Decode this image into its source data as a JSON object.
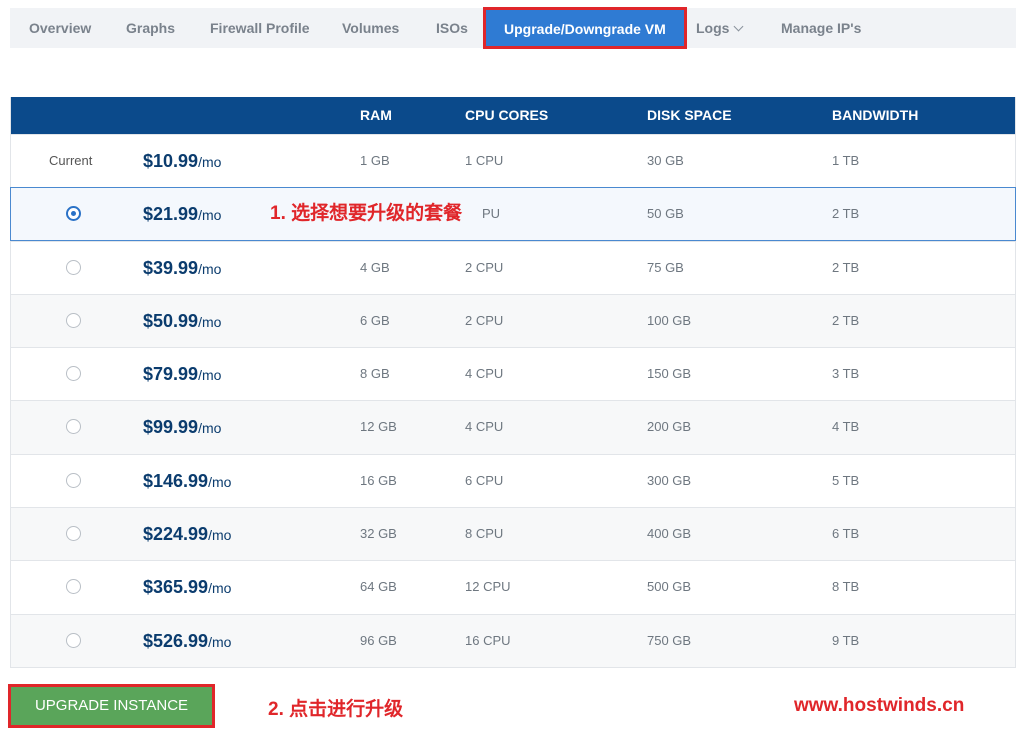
{
  "tabs": [
    {
      "label": "Overview"
    },
    {
      "label": "Graphs"
    },
    {
      "label": "Firewall Profile"
    },
    {
      "label": "Volumes"
    },
    {
      "label": "ISOs"
    },
    {
      "label": "Upgrade/Downgrade VM"
    },
    {
      "label": "Logs"
    },
    {
      "label": "Manage IP's"
    }
  ],
  "active_tab": "Upgrade/Downgrade VM",
  "table": {
    "headers": {
      "ram": "RAM",
      "cpu": "CPU CORES",
      "disk": "DISK SPACE",
      "bandwidth": "BANDWIDTH"
    },
    "current_label": "Current",
    "per_unit": "/mo",
    "rows": [
      {
        "price": "$10.99",
        "ram": "1 GB",
        "cpu": "1 CPU",
        "disk": "30 GB",
        "bandwidth": "1 TB",
        "status": "current"
      },
      {
        "price": "$21.99",
        "ram": "",
        "cpu": "PU",
        "disk": "50 GB",
        "bandwidth": "2 TB",
        "status": "selected"
      },
      {
        "price": "$39.99",
        "ram": "4 GB",
        "cpu": "2 CPU",
        "disk": "75 GB",
        "bandwidth": "2 TB",
        "status": "option"
      },
      {
        "price": "$50.99",
        "ram": "6 GB",
        "cpu": "2 CPU",
        "disk": "100 GB",
        "bandwidth": "2 TB",
        "status": "option"
      },
      {
        "price": "$79.99",
        "ram": "8 GB",
        "cpu": "4 CPU",
        "disk": "150 GB",
        "bandwidth": "3 TB",
        "status": "option"
      },
      {
        "price": "$99.99",
        "ram": "12 GB",
        "cpu": "4 CPU",
        "disk": "200 GB",
        "bandwidth": "4 TB",
        "status": "option"
      },
      {
        "price": "$146.99",
        "ram": "16 GB",
        "cpu": "6 CPU",
        "disk": "300 GB",
        "bandwidth": "5 TB",
        "status": "option"
      },
      {
        "price": "$224.99",
        "ram": "32 GB",
        "cpu": "8 CPU",
        "disk": "400 GB",
        "bandwidth": "6 TB",
        "status": "option"
      },
      {
        "price": "$365.99",
        "ram": "64 GB",
        "cpu": "12 CPU",
        "disk": "500 GB",
        "bandwidth": "8 TB",
        "status": "option"
      },
      {
        "price": "$526.99",
        "ram": "96 GB",
        "cpu": "16 CPU",
        "disk": "750 GB",
        "bandwidth": "9 TB",
        "status": "option"
      }
    ]
  },
  "annotations": {
    "step1": "1. 选择想要升级的套餐",
    "step2": "2. 点击进行升级",
    "site": "www.hostwinds.cn"
  },
  "button": {
    "upgrade_label": "UPGRADE INSTANCE"
  },
  "colors": {
    "header_bg": "#0b4a8b",
    "active_tab": "#2f7bd3",
    "button": "#5aa55a",
    "annotation": "#e0262a",
    "selected_border": "#4a89d0"
  },
  "icons": {
    "logs_dropdown": "chevron-down-icon",
    "plan_select": "radio-icon"
  }
}
